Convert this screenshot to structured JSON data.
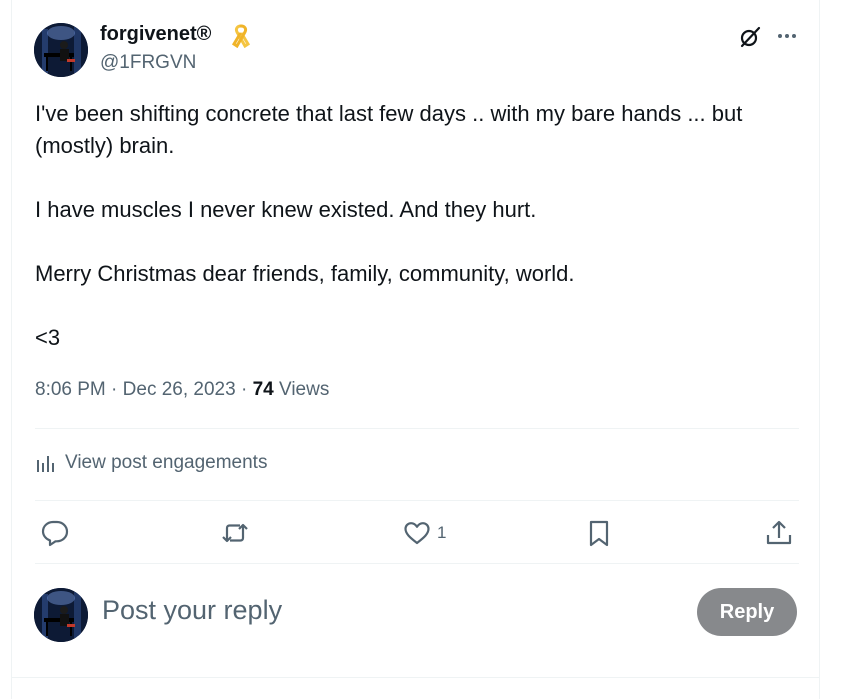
{
  "post": {
    "author": {
      "display_name": "forgivenet®",
      "handle": "@1FRGVN"
    },
    "body": {
      "line1": "I've been shifting concrete that last few days .. with my bare hands ... but (mostly) brain.",
      "line2": "I have muscles I never knew existed. And they hurt.",
      "line3": "Merry Christmas dear friends, family, community, world.",
      "line4": "<3"
    },
    "meta": {
      "time": "8:06 PM",
      "date": "Dec 26, 2023",
      "views_count": "74",
      "views_label": "Views",
      "separator": "·"
    },
    "engagements_link": "View post engagements",
    "actions": {
      "likes": "1"
    },
    "icons": {
      "badge": "yellow-ribbon-icon",
      "grok": "grok-icon",
      "more": "more-icon",
      "analytics": "bar-chart-icon",
      "reply": "reply-icon",
      "repost": "repost-icon",
      "like": "heart-icon",
      "bookmark": "bookmark-icon",
      "share": "share-icon"
    }
  },
  "reply_box": {
    "placeholder": "Post your reply",
    "button_label": "Reply"
  },
  "colors": {
    "text": "#0f1419",
    "muted": "#536471",
    "border": "#eff3f4",
    "reply_button": "#87898c",
    "ribbon": "#f5c542"
  }
}
